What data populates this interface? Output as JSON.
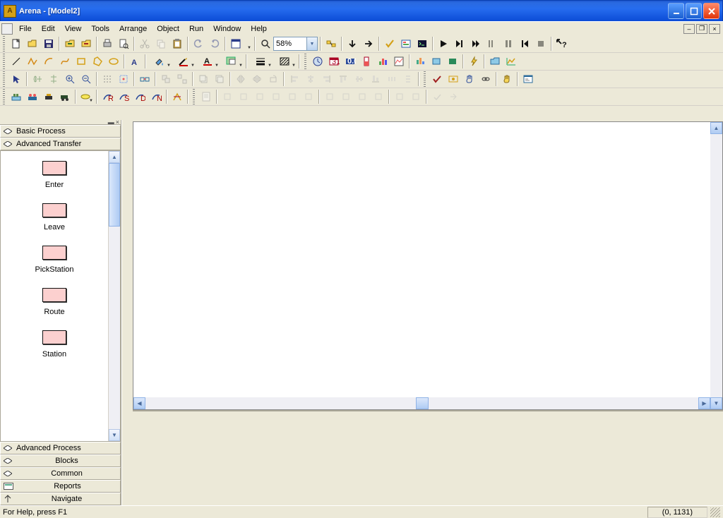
{
  "title": "Arena - [Model2]",
  "menu": [
    "File",
    "Edit",
    "View",
    "Tools",
    "Arrange",
    "Object",
    "Run",
    "Window",
    "Help"
  ],
  "zoom": "58%",
  "panel": {
    "categories_top": [
      "Basic Process",
      "Advanced Transfer"
    ],
    "categories_bottom": [
      "Advanced Process",
      "Blocks",
      "Common",
      "Reports",
      "Navigate"
    ],
    "active_category": "Advanced Transfer",
    "modules": [
      "Enter",
      "Leave",
      "PickStation",
      "Route",
      "Station"
    ]
  },
  "status": {
    "help": "For Help, press F1",
    "coords": "(0, 1131)"
  },
  "toolbar_icons": {
    "r1": [
      "new",
      "open",
      "save",
      "import",
      "export",
      "print",
      "preview",
      "cut",
      "copy",
      "paste",
      "undo",
      "redo",
      "layers",
      "zoom-tool",
      "zoom-box",
      "grid",
      "arrow-down",
      "go",
      "check",
      "breakpoint",
      "trace",
      "play",
      "end",
      "fast-forward",
      "step",
      "pause",
      "rewind",
      "stop",
      "context-help"
    ],
    "r2": [
      "line",
      "connector",
      "curve",
      "polyline",
      "rect",
      "poly",
      "ellipse",
      "text",
      "fill",
      "stroke",
      "font",
      "at",
      "lines",
      "hatch",
      "pie",
      "cc",
      "clock",
      "meter-red",
      "chart",
      "gauge",
      "chart2",
      "level",
      "gauge2",
      "bolt",
      "folder",
      "chart3"
    ],
    "r3": [
      "pointer",
      "align-l",
      "align-r",
      "align-t",
      "align-b",
      "dots",
      "gridsnap",
      "fit",
      "group",
      "ungroup",
      "front",
      "back",
      "rotate",
      "flip",
      "flipv",
      "dist-h",
      "dist-v",
      "a",
      "b",
      "c",
      "d",
      "e",
      "check2",
      "hand",
      "eye",
      "link",
      "hand2",
      "props"
    ],
    "r4": [
      "s1",
      "s2",
      "s3",
      "s4",
      "tag",
      "tag2",
      "sr",
      "ss",
      "sd",
      "sn",
      "meas",
      "sheet",
      "g1",
      "g2",
      "g3",
      "g4",
      "g5",
      "g6",
      "h1",
      "h2",
      "h3",
      "h4",
      "i1",
      "i2",
      "j1",
      "j2"
    ]
  }
}
